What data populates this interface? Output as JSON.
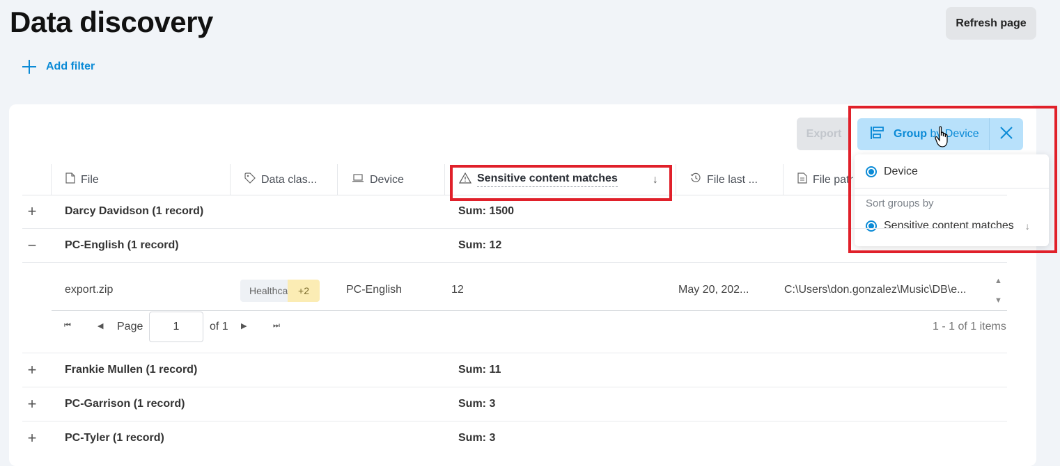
{
  "page": {
    "title": "Data discovery",
    "refresh_label": "Refresh page",
    "add_filter_label": "Add filter"
  },
  "toolbar": {
    "export_label": "Export",
    "group_prefix": "Group",
    "group_suffix": "by Device"
  },
  "dropdown": {
    "group_option": "Device",
    "sort_label": "Sort groups by",
    "sort_option": "Sensitive content matches"
  },
  "table": {
    "headers": {
      "file": "File",
      "data_class": "Data clas...",
      "device": "Device",
      "sensitive": "Sensitive content matches",
      "file_last": "File last ...",
      "file_path": "File path"
    },
    "groups": [
      {
        "label": "Darcy Davidson (1 record)",
        "sum": "Sum: 1500",
        "expanded": false
      },
      {
        "label": "PC-English (1 record)",
        "sum": "Sum: 12",
        "expanded": true
      },
      {
        "label": "Frankie Mullen (1 record)",
        "sum": "Sum: 11",
        "expanded": false
      },
      {
        "label": "PC-Garrison (1 record)",
        "sum": "Sum: 3",
        "expanded": false
      },
      {
        "label": "PC-Tyler (1 record)",
        "sum": "Sum: 3",
        "expanded": false
      }
    ],
    "record": {
      "file": "export.zip",
      "data_class": "Healthcare",
      "data_class_more": "+2",
      "device": "PC-English",
      "matches": "12",
      "file_last": "May 20, 202...",
      "path": "C:\\Users\\don.gonzalez\\Music\\DB\\e..."
    }
  },
  "pager": {
    "page_label": "Page",
    "page_value": "1",
    "of_label": "of 1",
    "items_label": "1 - 1 of 1 items"
  },
  "colors": {
    "accent": "#0a8ad6",
    "highlight": "#e0202a",
    "group_button_bg": "#b8e1fb",
    "badge_more_bg": "#fbecb4"
  }
}
